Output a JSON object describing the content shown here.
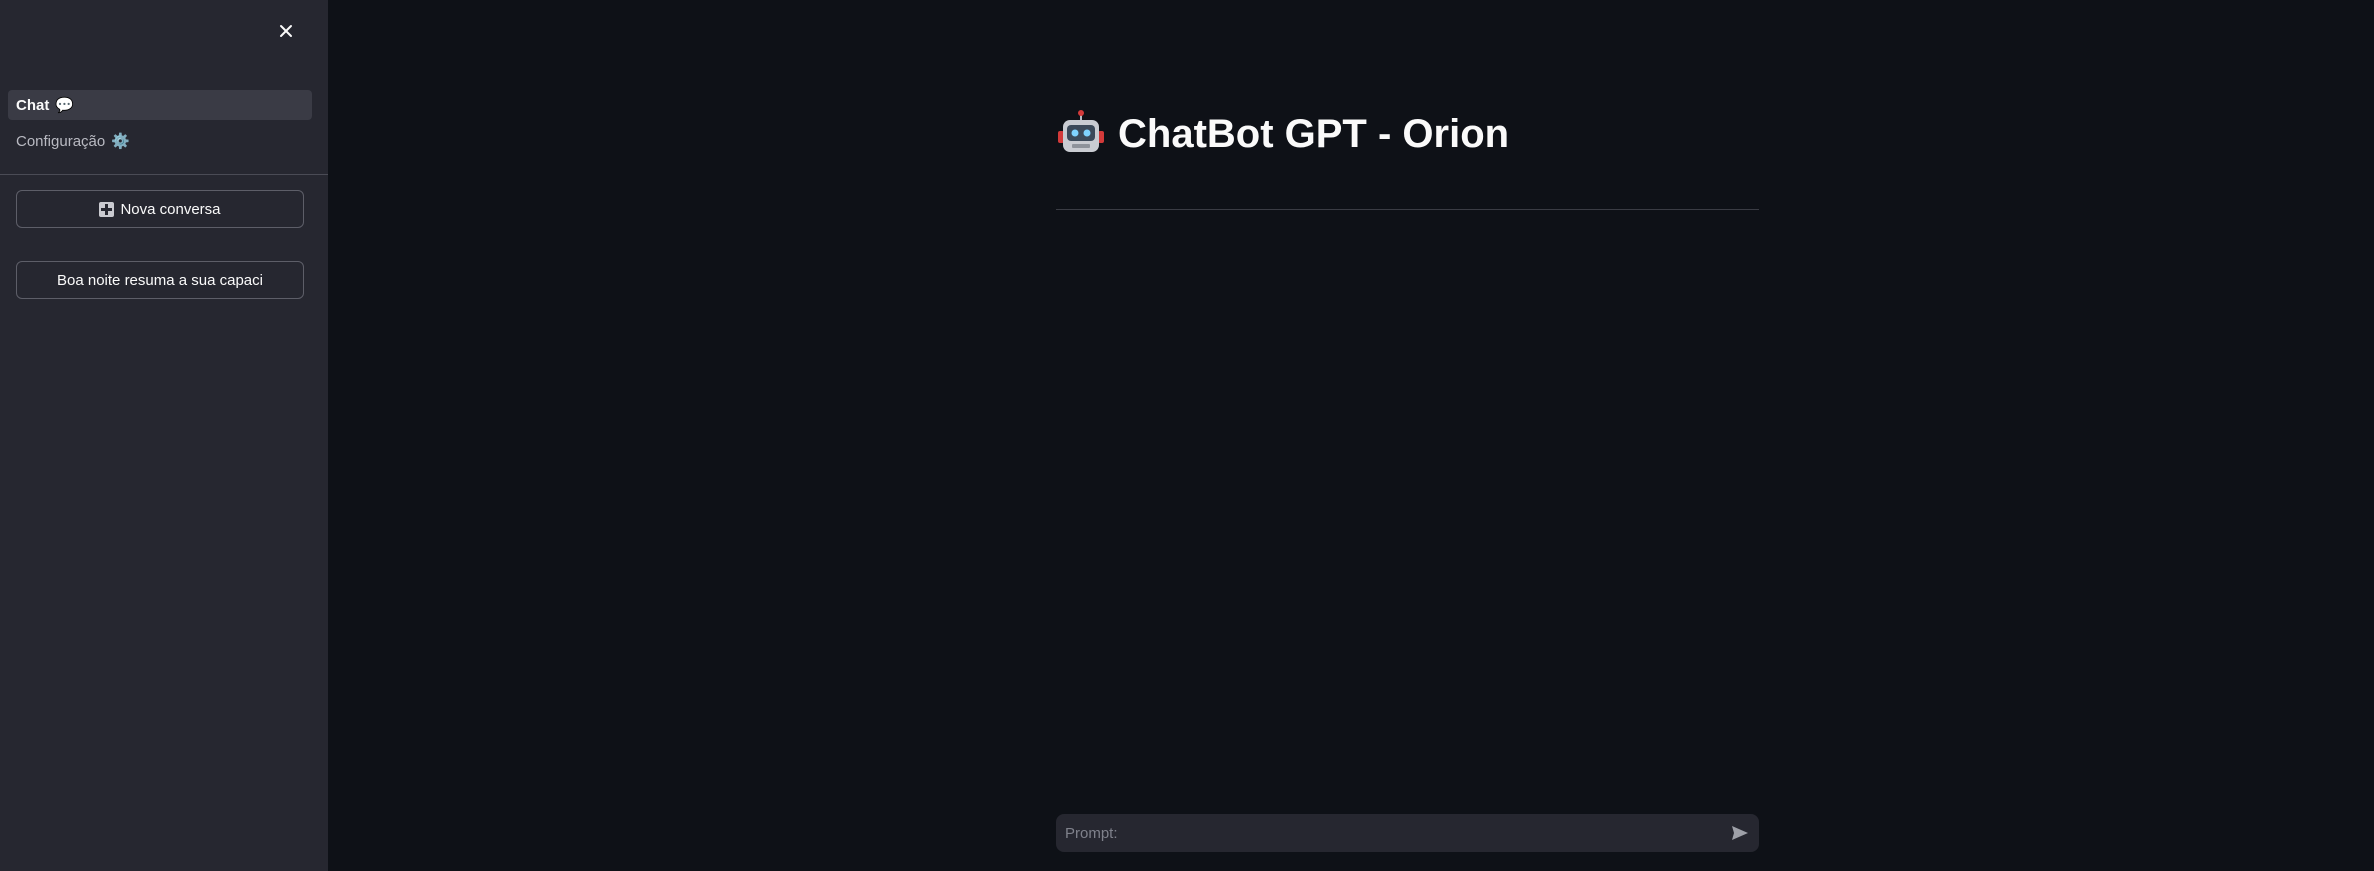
{
  "sidebar": {
    "close_icon": "close-icon",
    "nav": [
      {
        "label": "Chat",
        "icon": "💬",
        "active": true
      },
      {
        "label": "Configuração",
        "icon": "⚙️",
        "active": false
      }
    ],
    "new_chat_icon": "plus-icon",
    "new_chat_label": "Nova conversa",
    "history": [
      {
        "label": "Boa noite resuma a sua capaci"
      }
    ]
  },
  "main": {
    "title_icon": "robot-icon",
    "title": "ChatBot GPT - Orion",
    "prompt": {
      "placeholder": "Prompt:",
      "value": "",
      "send_icon": "send-icon"
    }
  },
  "colors": {
    "background": "#0e1117",
    "sidebar": "#262730",
    "text": "#fafafa"
  }
}
